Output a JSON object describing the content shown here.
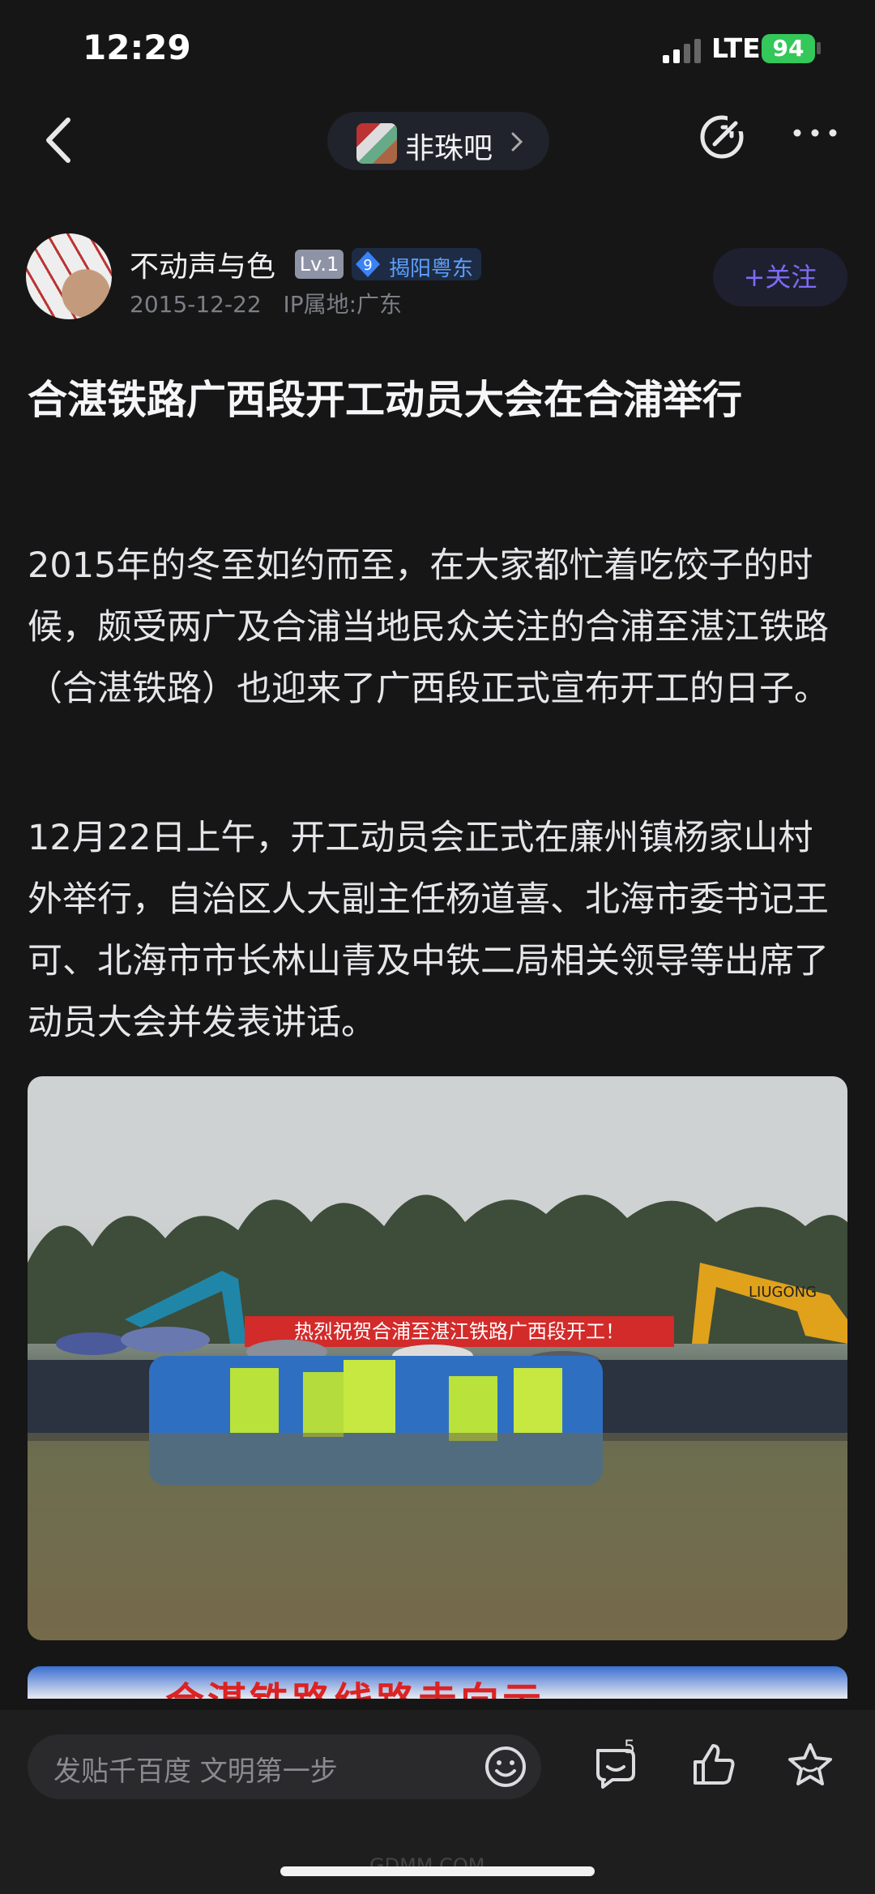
{
  "status": {
    "time": "12:29",
    "network": "LTE",
    "battery": "94"
  },
  "nav": {
    "forum_name": "非珠吧"
  },
  "author": {
    "name": "不动声与色",
    "level": "Lv.1",
    "region_badge_num": "9",
    "region": "揭阳粤东",
    "date": "2015-12-22",
    "ip": "IP属地:广东",
    "follow_label": "+关注"
  },
  "post": {
    "title": "合湛铁路广西段开工动员大会在合浦举行",
    "paragraphs": [
      "2015年的冬至如约而至，在大家都忙着吃饺子的时候，颇受两广及合浦当地民众关注的合浦至湛江铁路（合湛铁路）也迎来了广西段正式宣布开工的日子。",
      "12月22日上午，开工动员会正式在廉州镇杨家山村外举行，自治区人大副主任杨道喜、北海市委书记王可、北海市市长林山青及中铁二局相关领导等出席了动员大会并发表讲话。"
    ],
    "photo_banner": "热烈祝贺合浦至湛江铁路广西段开工！",
    "photo_excavator_brand": "LIUGONG",
    "photo2_text": "合湛铁路线路走向示"
  },
  "bottom": {
    "input_placeholder": "发贴千百度 文明第一步",
    "comment_count": "5",
    "watermark": "GDMM.COM"
  }
}
